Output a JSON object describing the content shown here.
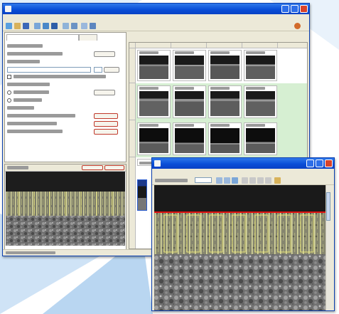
{
  "theme": {
    "page_bg": "#ffffff",
    "decor_light": "#d4e6f8",
    "decor_mid": "#a9cdef",
    "titlebar_blue": "#0a4fd8",
    "close_red": "#d8432a",
    "highlight_green": "#d6efd2",
    "accent_red": "#e01010",
    "selection_yellow": "#f3ef7a",
    "dark_band": "#1a1a1a",
    "micrograph_gray": "#6e6e6e"
  },
  "main_window": {
    "title": "",
    "menu": [],
    "toolbar_icons": [
      "new-icon",
      "open-icon",
      "save-icon",
      "print-icon",
      "scan-icon",
      "camera-icon",
      "report-icon",
      "settings-icon",
      "grid-icon",
      "export-icon",
      "help-icon"
    ],
    "close_icon": "close-icon",
    "min_icon": "minimize-icon",
    "max_icon": "maximize-icon",
    "left_tabs": [
      {
        "label": "",
        "active": true
      },
      {
        "label": "",
        "active": false
      }
    ],
    "grid": {
      "rows": 4,
      "cols": 5,
      "highlighted_rows": [
        1,
        2
      ]
    },
    "status": ""
  },
  "image_window": {
    "title": "",
    "menu": [],
    "toolbar_icons": [
      "zoom-in-icon",
      "zoom-out-icon",
      "fit-icon",
      "pan-icon",
      "measure-icon",
      "line-icon",
      "rect-icon",
      "undo-icon"
    ],
    "zoom_level": "",
    "measurement_line_color": "#e01010",
    "selection_columns": 7
  }
}
